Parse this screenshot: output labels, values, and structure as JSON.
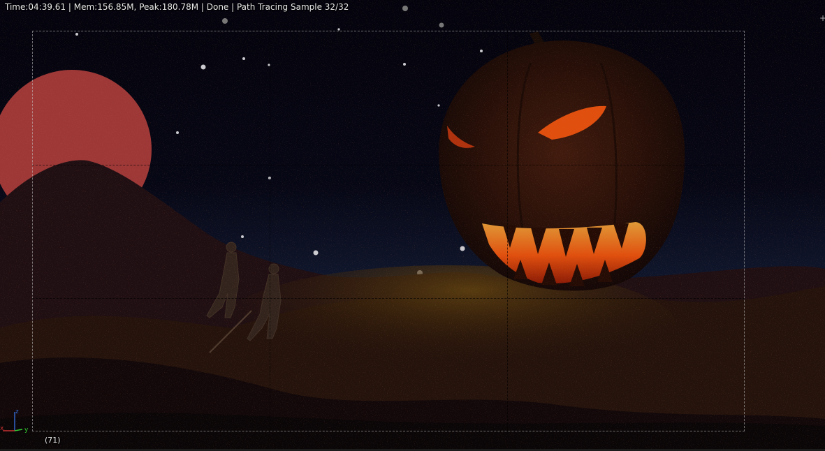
{
  "header": {
    "render_stats": "Time:04:39.61 | Mem:156.85M, Peak:180.78M | Done | Path Tracing Sample 32/32"
  },
  "viewport": {
    "frame_number": "(71)",
    "axis_labels": {
      "x": "x",
      "y": "y",
      "z": "z"
    }
  },
  "colors": {
    "sky_dark": "#05040f",
    "moon": "#b3403f",
    "pumpkin_glow": "#ff5a10",
    "axis_x": "#c83232",
    "axis_y": "#32c832",
    "axis_z": "#3264c8"
  },
  "icons": {
    "corner": "plus-icon"
  }
}
